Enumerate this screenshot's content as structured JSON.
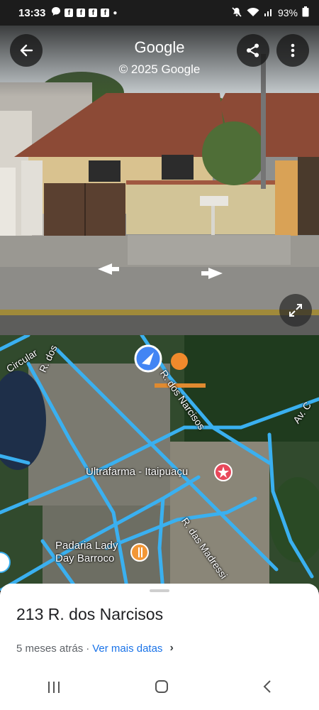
{
  "status_bar": {
    "time": "13:33",
    "notification_icons": [
      "message-icon",
      "facebook-icon",
      "facebook-icon",
      "facebook-icon",
      "facebook-icon",
      "dot-icon"
    ],
    "battery": "93%"
  },
  "street_view": {
    "title": "Google",
    "copyright": "© 2025 Google"
  },
  "map": {
    "street_labels": [
      "R. dos",
      "Circular",
      "R. dos Narcisos",
      "Av. C",
      "R. das Madressi"
    ],
    "places": [
      {
        "name": "Ultrafarma - Itaipuaçu",
        "icon": "pharmacy-icon"
      },
      {
        "name_line1": "Padaria Lady",
        "name_line2": "Day Barroco",
        "icon": "bakery-icon"
      }
    ]
  },
  "sheet": {
    "address": "213 R. dos Narcisos",
    "date_text": "5 meses atrás",
    "separator": "·",
    "more_dates_link": "Ver mais datas"
  },
  "colors": {
    "link": "#1a73e8",
    "road": "#3ab0f0",
    "place_pin_pharmacy": "#e8485b",
    "place_pin_bakery": "#f29736"
  }
}
